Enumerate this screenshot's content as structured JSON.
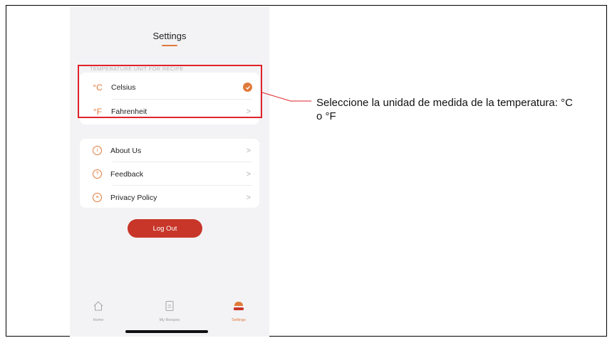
{
  "header": {
    "title": "Settings"
  },
  "temperature": {
    "section_label": "TEMPERATURE UNIT FOR RECIPE",
    "options": [
      {
        "symbol": "°C",
        "label": "Celsius",
        "selected": true
      },
      {
        "symbol": "°F",
        "label": "Fahrenheit",
        "selected": false
      }
    ]
  },
  "menu": {
    "items": [
      {
        "label": "About Us",
        "icon": "info-icon"
      },
      {
        "label": "Feedback",
        "icon": "question-icon"
      },
      {
        "label": "Privacy Policy",
        "icon": "document-icon"
      }
    ]
  },
  "logout": {
    "label": "Log Out"
  },
  "tabs": [
    {
      "label": "Home",
      "icon": "home-icon",
      "active": false
    },
    {
      "label": "My Recipes",
      "icon": "recipe-book-icon",
      "active": false
    },
    {
      "label": "Settings",
      "icon": "settings-pot-icon",
      "active": true
    }
  ],
  "annotation": {
    "text": "Seleccione la unidad de medida de la temperatura: °C o °F"
  },
  "colors": {
    "accent": "#e07a3a",
    "logout": "#c8362a",
    "highlight": "#e0232a"
  }
}
